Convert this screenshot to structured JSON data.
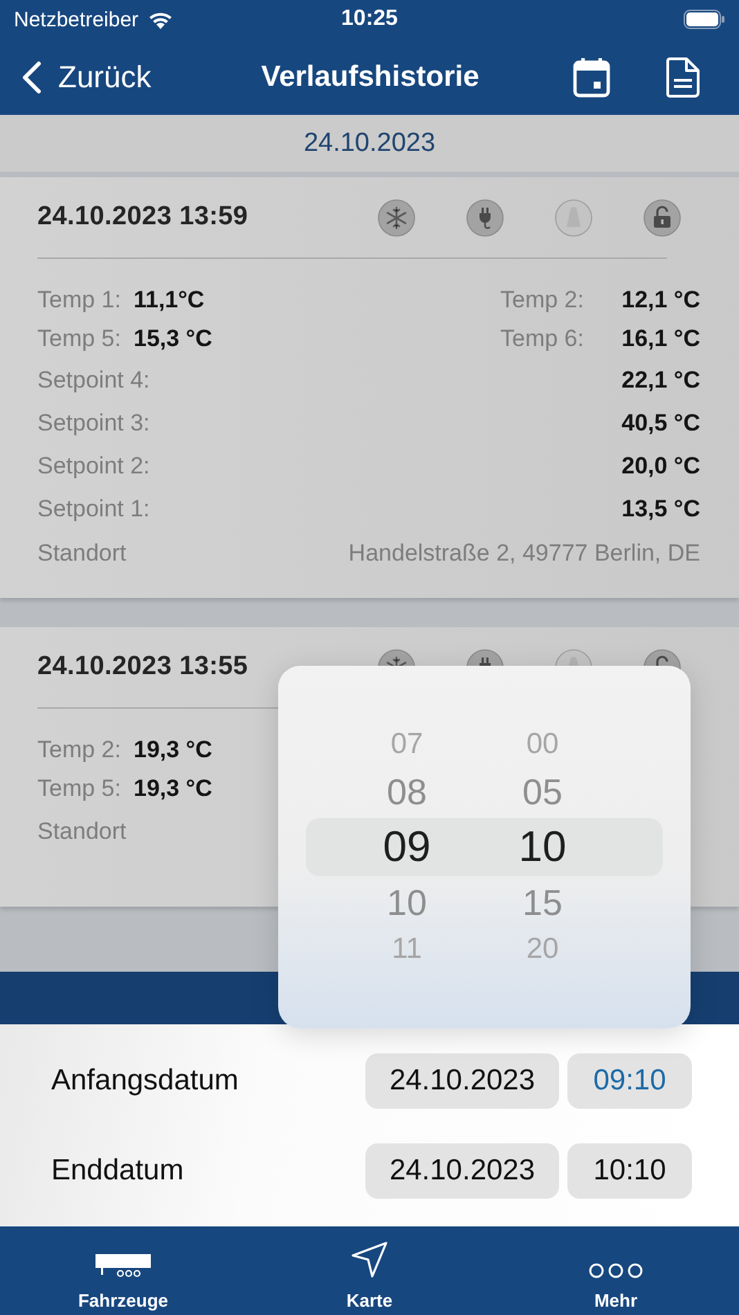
{
  "status_bar": {
    "carrier": "Netzbetreiber",
    "time": "10:25"
  },
  "nav": {
    "back": "Zurück",
    "title": "Verlaufshistorie"
  },
  "date_header": "24.10.2023",
  "cards": [
    {
      "timestamp": "24.10.2023 13:59",
      "icons": [
        {
          "kind": "snowflake",
          "active": true
        },
        {
          "kind": "plug",
          "active": true
        },
        {
          "kind": "weight",
          "active": false
        },
        {
          "kind": "lock",
          "active": true
        }
      ],
      "rows": [
        {
          "kind": "pair",
          "items": [
            {
              "label": "Temp 1:",
              "value": "11,1°C"
            },
            {
              "label": "Temp 2:",
              "value": "12,1 °C"
            }
          ]
        },
        {
          "kind": "pair",
          "items": [
            {
              "label": "Temp 5:",
              "value": "15,3 °C"
            },
            {
              "label": "Temp 6:",
              "value": "16,1 °C"
            }
          ]
        },
        {
          "kind": "single",
          "label": "Setpoint 4:",
          "value": "22,1 °C"
        },
        {
          "kind": "single",
          "label": "Setpoint 3:",
          "value": "40,5 °C"
        },
        {
          "kind": "single",
          "label": "Setpoint 2:",
          "value": "20,0 °C"
        },
        {
          "kind": "single",
          "label": "Setpoint 1:",
          "value": "13,5 °C"
        },
        {
          "kind": "location",
          "label": "Standort",
          "value": "Handelstraße 2, 49777 Berlin, DE"
        }
      ]
    },
    {
      "timestamp": "24.10.2023 13:55",
      "icons": [
        {
          "kind": "snowflake",
          "active": true
        },
        {
          "kind": "plug",
          "active": true
        },
        {
          "kind": "weight",
          "active": false
        },
        {
          "kind": "lock",
          "active": true
        }
      ],
      "rows": [
        {
          "kind": "pair",
          "items": [
            {
              "label": "Temp 2:",
              "value": "19,3 °C"
            }
          ]
        },
        {
          "kind": "pair",
          "items": [
            {
              "label": "Temp 5:",
              "value": "19,3 °C"
            }
          ]
        },
        {
          "kind": "location",
          "label": "Standort"
        }
      ]
    }
  ],
  "picker": {
    "hours": [
      {
        "label": "07",
        "selected": false
      },
      {
        "label": "08",
        "selected": false
      },
      {
        "label": "09",
        "selected": true
      },
      {
        "label": "10",
        "selected": false
      },
      {
        "label": "11",
        "selected": false
      }
    ],
    "minutes": [
      {
        "label": "00",
        "selected": false
      },
      {
        "label": "05",
        "selected": false
      },
      {
        "label": "10",
        "selected": true
      },
      {
        "label": "15",
        "selected": false
      },
      {
        "label": "20",
        "selected": false
      }
    ]
  },
  "range": [
    {
      "label": "Anfangsdatum",
      "date": "24.10.2023",
      "time": "09:10",
      "time_active": true
    },
    {
      "label": "Enddatum",
      "date": "24.10.2023",
      "time": "10:10",
      "time_active": false
    }
  ],
  "tab_bar": [
    {
      "kind": "trailer",
      "label": "Fahrzeuge"
    },
    {
      "kind": "navigation",
      "label": "Karte"
    },
    {
      "kind": "more",
      "label": "Mehr"
    }
  ]
}
